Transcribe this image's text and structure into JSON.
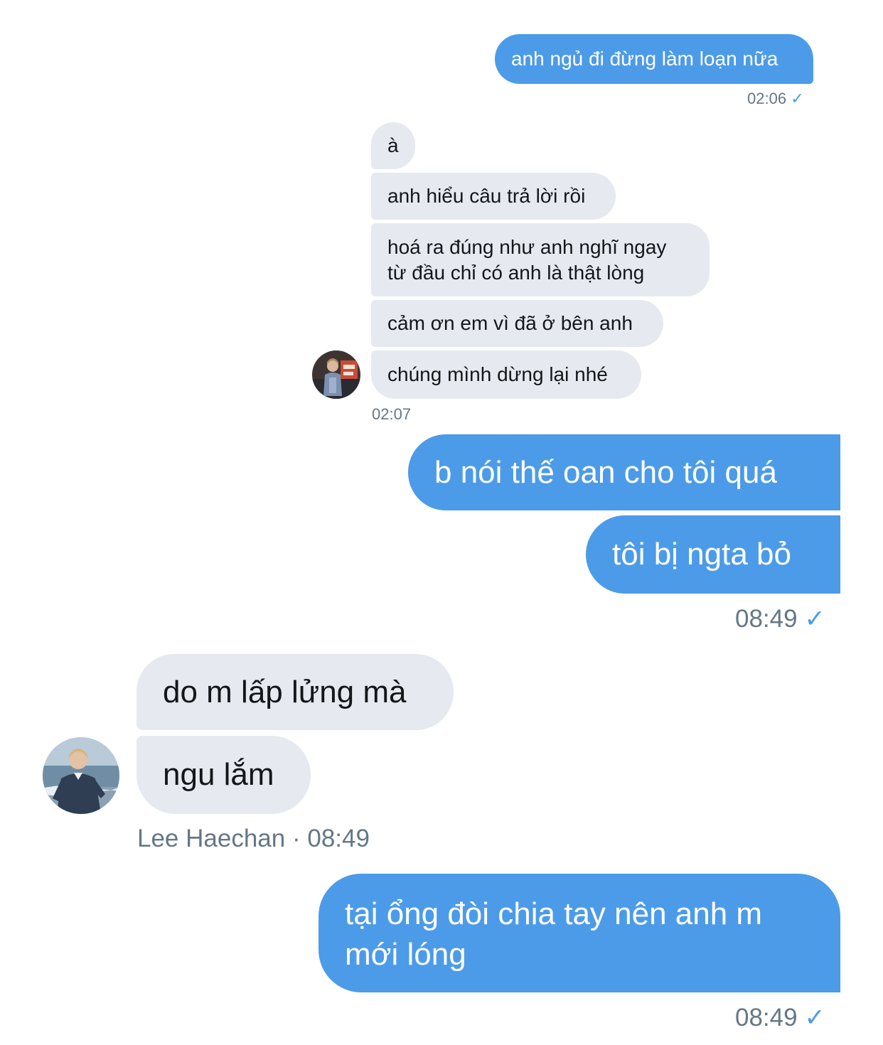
{
  "thread_top": {
    "sent_1": {
      "text": "anh ngủ đi đừng làm loạn nữa",
      "time": "02:06",
      "status_icon": "✓"
    },
    "received_group": {
      "messages": [
        "à",
        "anh hiểu câu trả lời rồi",
        "hoá ra đúng như anh nghĩ ngay",
        "từ đầu chỉ có anh là thật lòng",
        "cảm ơn em vì đã ở bên anh",
        "chúng mình dừng lại nhé"
      ],
      "time": "02:07"
    }
  },
  "thread_bottom": {
    "sent_group": {
      "messages": [
        "b nói thế oan cho tôi quá",
        "tôi bị ngta bỏ"
      ],
      "time": "08:49",
      "status_icon": "✓"
    },
    "received_group": {
      "messages": [
        "do m lấp lửng mà",
        "ngu lắm"
      ],
      "sender": "Lee Haechan",
      "separator": "·",
      "time": "08:49"
    },
    "sent_last": {
      "line_1": "tại ổng đòi chia tay nên anh m",
      "line_2": "mới lóng",
      "time": "08:49",
      "status_icon": "✓"
    }
  },
  "colors": {
    "outgoing_bubble": "#4c9be8",
    "incoming_bubble": "#e6e9ef",
    "meta_text": "#657786",
    "read_check": "#4c9be8"
  }
}
